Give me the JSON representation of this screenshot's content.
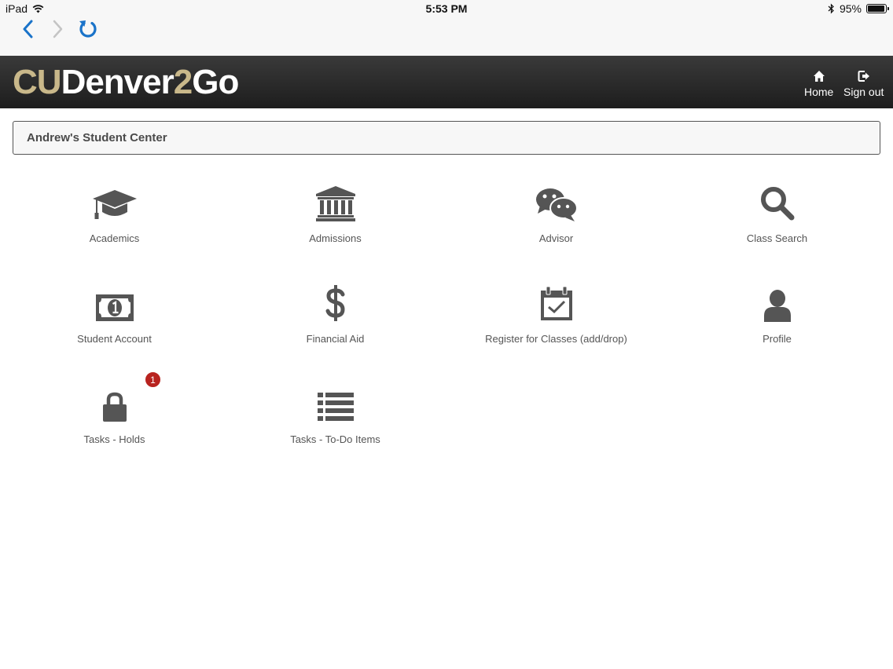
{
  "statusbar": {
    "device": "iPad",
    "time": "5:53 PM",
    "battery_label": "95%",
    "battery_level": 0.95
  },
  "browser": {
    "back_icon": "chevron-left-icon",
    "forward_icon": "chevron-right-icon",
    "reload_icon": "reload-icon",
    "accent": "#1a73c9"
  },
  "header": {
    "logo_part1": "CU",
    "logo_part2": "Denver",
    "logo_part3": "2",
    "logo_part4": "Go",
    "home_label": "Home",
    "signout_label": "Sign out"
  },
  "center": {
    "title": "Andrew's Student Center"
  },
  "tiles": [
    {
      "label": "Academics",
      "icon": "graduation-cap-icon"
    },
    {
      "label": "Admissions",
      "icon": "institution-icon"
    },
    {
      "label": "Advisor",
      "icon": "chat-bubbles-icon"
    },
    {
      "label": "Class Search",
      "icon": "search-icon"
    },
    {
      "label": "Student Account",
      "icon": "money-icon"
    },
    {
      "label": "Financial Aid",
      "icon": "dollar-icon"
    },
    {
      "label": "Register for Classes (add/drop)",
      "icon": "calendar-check-icon"
    },
    {
      "label": "Profile",
      "icon": "user-icon"
    },
    {
      "label": "Tasks - Holds",
      "icon": "lock-icon",
      "badge": "1"
    },
    {
      "label": "Tasks - To-Do Items",
      "icon": "list-icon"
    }
  ],
  "colors": {
    "logo_gold": "#c9b88a",
    "icon_gray": "#555555",
    "badge_red": "#b8231f"
  }
}
